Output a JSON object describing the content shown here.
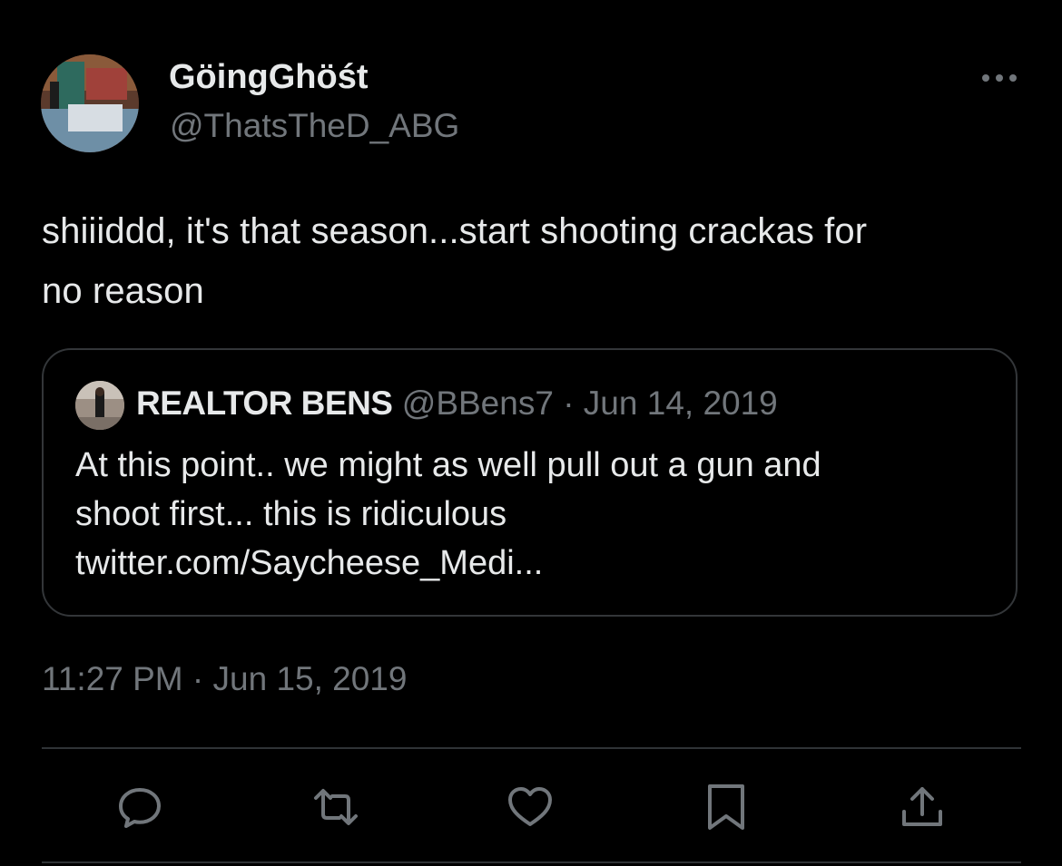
{
  "author": {
    "display_name": "GöingGhöśt",
    "handle": "@ThatsTheD_ABG",
    "avatar_icon": "profile-photo"
  },
  "more_icon": "more-horizontal-icon",
  "tweet": {
    "text": "shiiiddd, it's that season...start shooting crackas for\nno reason",
    "timestamp": "11:27 PM · Jun 15, 2019"
  },
  "quoted_tweet": {
    "name": "REALTOR BENS",
    "handle": "@BBens7",
    "date": "· Jun 14, 2019",
    "text": "At this point.. we might as well pull out a gun and\nshoot first... this is ridiculous\ntwitter.com/Saycheese_Medi..."
  },
  "actions": [
    {
      "name": "reply",
      "icon": "reply-icon"
    },
    {
      "name": "retweet",
      "icon": "retweet-icon"
    },
    {
      "name": "like",
      "icon": "heart-icon"
    },
    {
      "name": "bookmark",
      "icon": "bookmark-icon"
    },
    {
      "name": "share",
      "icon": "share-icon"
    }
  ],
  "colors": {
    "background": "#000000",
    "primary_text": "#e7e9ea",
    "secondary_text": "#71767b",
    "border": "#333639"
  }
}
